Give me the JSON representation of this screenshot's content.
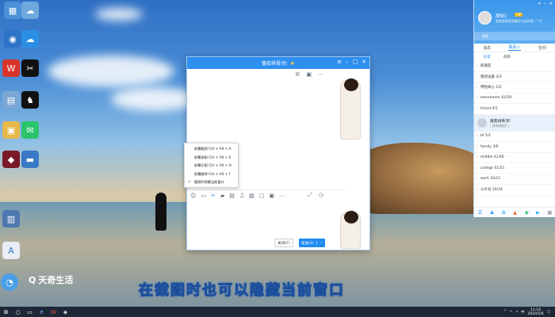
{
  "chat_window": {
    "title": "蔷茹排骨汤!",
    "close_label": "关闭(C)",
    "send_label": "发送(S)",
    "screenshot_menu": [
      "屏幕截图 Ctrl + Alt + A",
      "屏幕录制 Ctrl + Alt + S",
      "屏幕识图 Ctrl + Alt + O",
      "屏幕翻译 Ctrl + Alt + F",
      "截图时隐藏当前窗口"
    ]
  },
  "qq_panel": {
    "user_name": "周砧!",
    "sign": "我我我我我我握住兄弟的第一^A",
    "search_placeholder": "搜索",
    "tabs": [
      "消息",
      "联系人",
      "空间"
    ],
    "subtabs": [
      "好友",
      "群聊"
    ],
    "groups": [
      "新朋友",
      "我的设备 3/3",
      "特别关心 1/2",
      "emmmmm 42/59",
      "friend 0/1"
    ],
    "active_contact": {
      "name": "蔷茹排骨汤!",
      "status": "[ 离线请留言 ]"
    },
    "groups_after": [
      "bf 1/1",
      "family 3/9",
      "middle 41/46",
      "college 41/51",
      "work 10/11",
      "公众号 24/24"
    ]
  },
  "caption": "在截图时也可以隐藏当前窗口",
  "watermark": "天奇生活",
  "clock": {
    "time": "11:14",
    "date": "2020/1/6"
  }
}
